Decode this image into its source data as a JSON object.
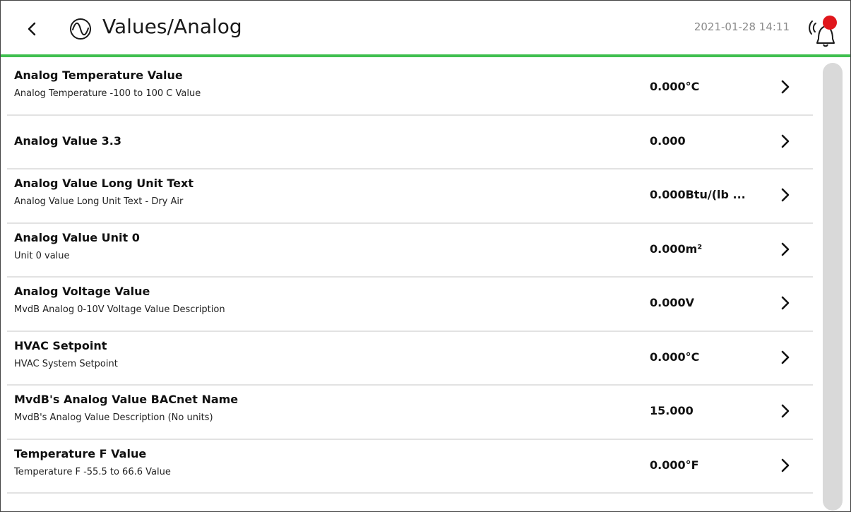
{
  "header": {
    "title": "Values/Analog",
    "datetime": "2021-01-28 14:11",
    "accent_color": "#3fbf4f",
    "alarm_dot_color": "#e0161c"
  },
  "icons": {
    "back": "chevron-left-icon",
    "section": "sine-wave-icon",
    "alarm": "alarm-bell-icon",
    "row_arrow": "chevron-right-icon"
  },
  "rows": [
    {
      "name": "Analog Temperature Value",
      "description": "Analog Temperature -100 to 100 C Value",
      "value": "0.000°C"
    },
    {
      "name": "Analog Value 3.3",
      "description": "",
      "value": "0.000"
    },
    {
      "name": "Analog Value Long Unit Text",
      "description": "Analog Value Long Unit Text - Dry Air",
      "value": "0.000Btu/(lb ..."
    },
    {
      "name": "Analog Value Unit 0",
      "description": "Unit 0 value",
      "value": "0.000m²"
    },
    {
      "name": "Analog Voltage Value",
      "description": "MvdB Analog 0-10V Voltage Value Description",
      "value": "0.000V"
    },
    {
      "name": "HVAC Setpoint",
      "description": "HVAC System Setpoint",
      "value": "0.000°C"
    },
    {
      "name": "MvdB's Analog Value BACnet Name",
      "description": "MvdB's Analog Value Description (No units)",
      "value": "15.000"
    },
    {
      "name": "Temperature F Value",
      "description": "Temperature F -55.5 to 66.6 Value",
      "value": "0.000°F"
    }
  ]
}
